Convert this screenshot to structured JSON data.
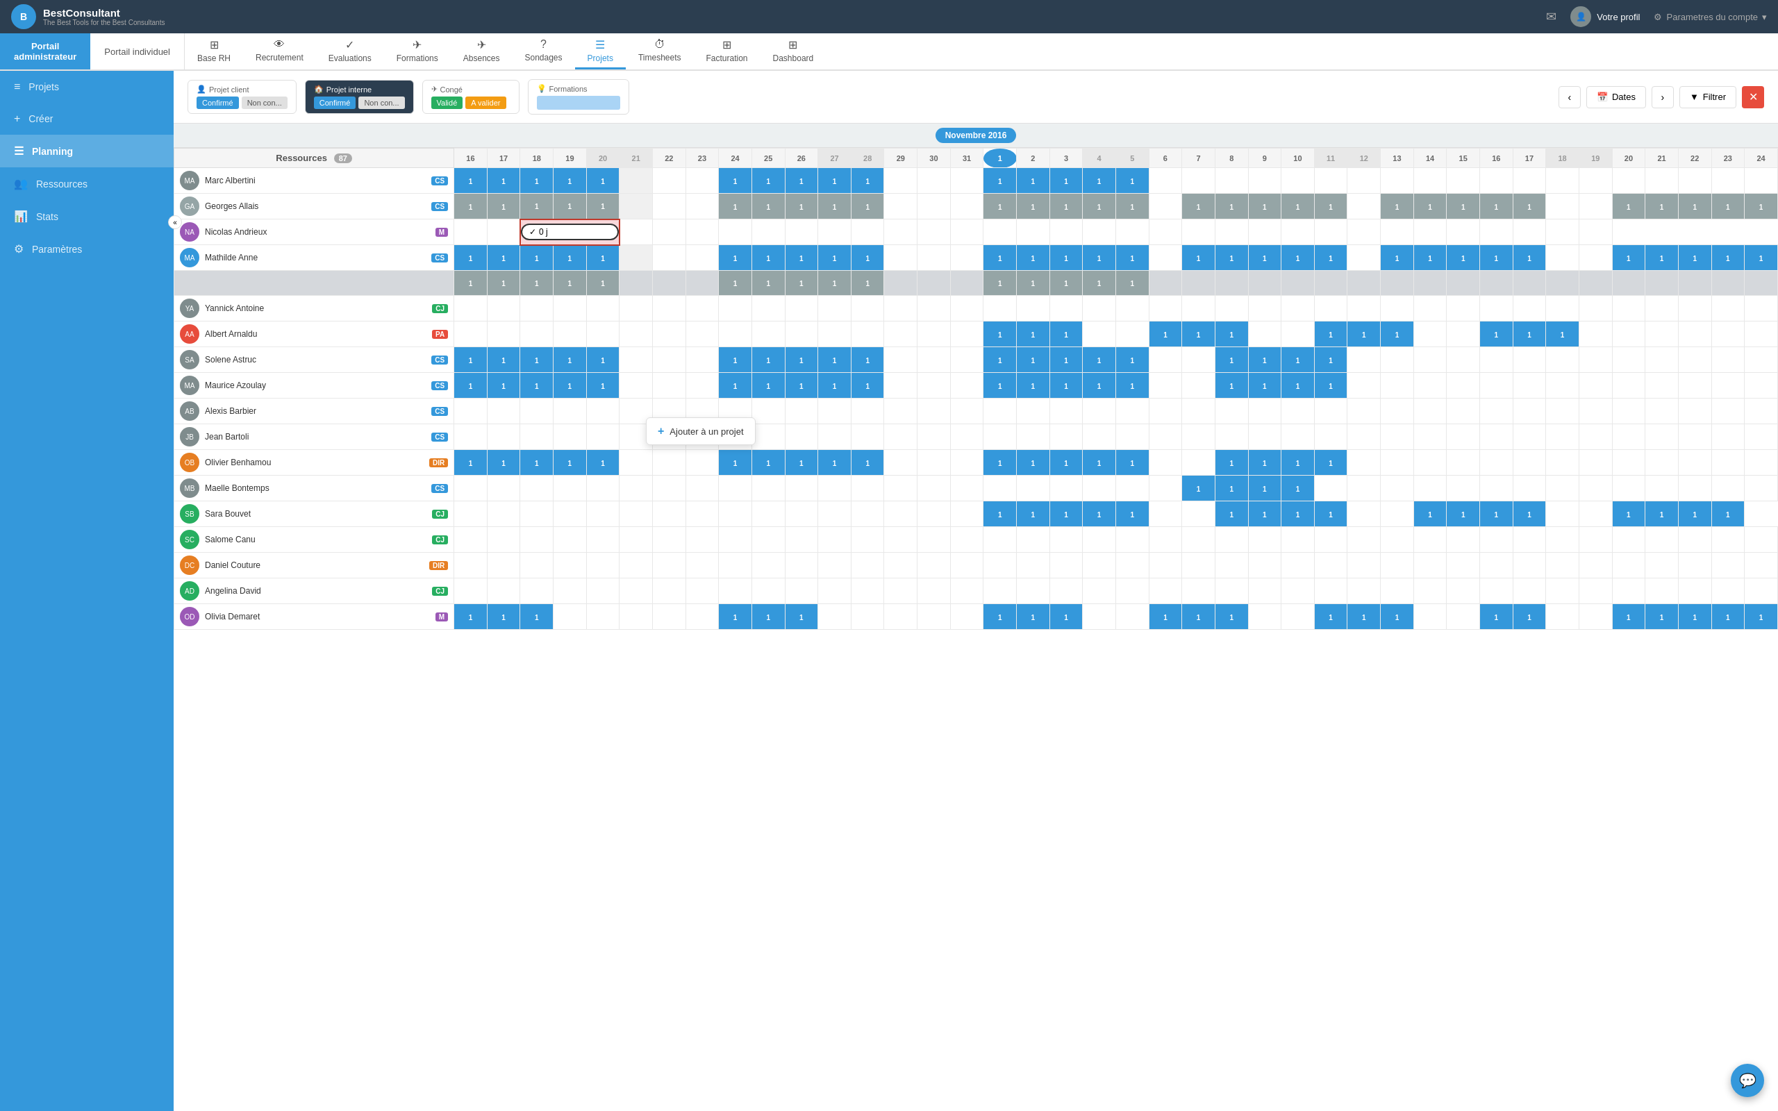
{
  "app": {
    "logo_letter": "B",
    "logo_title": "BestConsultant",
    "logo_sub": "The Best Tools for the Best Consultants",
    "top_right": {
      "mail_icon": "✉",
      "profile_label": "Votre profil",
      "params_label": "Parametres du compte"
    }
  },
  "nav": {
    "portal_admin_label": "Portail",
    "portal_admin_sub": "administrateur",
    "portal_individual_label": "Portail individuel",
    "tabs": [
      {
        "label": "Base RH",
        "icon": "⊞"
      },
      {
        "label": "Recrutement",
        "icon": "👁"
      },
      {
        "label": "Evaluations",
        "icon": "✓"
      },
      {
        "label": "Formations",
        "icon": "✈"
      },
      {
        "label": "Absences",
        "icon": "✈"
      },
      {
        "label": "Sondages",
        "icon": "?"
      },
      {
        "label": "Projets",
        "icon": "☰",
        "active": true
      },
      {
        "label": "Timesheets",
        "icon": "⏱"
      },
      {
        "label": "Facturation",
        "icon": "⊞"
      },
      {
        "label": "Dashboard",
        "icon": "⊞"
      }
    ]
  },
  "sidebar": {
    "items": [
      {
        "label": "Projets",
        "icon": "≡"
      },
      {
        "label": "Créer",
        "icon": "+"
      },
      {
        "label": "Planning",
        "icon": "☰",
        "active": true
      },
      {
        "label": "Ressources",
        "icon": "👥"
      },
      {
        "label": "Stats",
        "icon": "📊"
      },
      {
        "label": "Paramètres",
        "icon": "⚙"
      }
    ]
  },
  "toolbar": {
    "projet_client_label": "Projet client",
    "projet_client_icon": "👤",
    "btn_confirmed": "Confirmé",
    "btn_non_confirmed": "Non con...",
    "projet_interne_label": "Projet interne",
    "projet_interne_icon": "🏠",
    "btn_confirmed2": "Confirmé",
    "btn_non_confirmed2": "Non con...",
    "conge_label": "Congé",
    "conge_icon": "✈",
    "btn_valide": "Validé",
    "btn_avalider": "A valider",
    "formations_label": "Formations",
    "formations_icon": "💡",
    "dates_label": "Dates",
    "filter_label": "Filtrer",
    "resources_label": "Ressources",
    "resources_count": "87"
  },
  "calendar": {
    "month_label": "Novembre 2016",
    "days_first": [
      16,
      17,
      18,
      19,
      20,
      21,
      22,
      23,
      24,
      25,
      26,
      27,
      28,
      29,
      30,
      31,
      1,
      2,
      3,
      4,
      5,
      6,
      7,
      8,
      9,
      10,
      11,
      12,
      13,
      14,
      15,
      16,
      17,
      18,
      19,
      20,
      21,
      22,
      23,
      24
    ],
    "today": 1
  },
  "popup": {
    "label": "Ajouter à un projet",
    "icon": "+"
  },
  "resources": [
    {
      "name": "Marc Albertini",
      "role": "CS",
      "role_class": "role-cs",
      "color_avatar": "#7f8c8d"
    },
    {
      "name": "Georges Allais",
      "role": "CS",
      "role_class": "role-cs",
      "color_avatar": "#7f8c8d"
    },
    {
      "name": "Nicolas Andrieux",
      "role": "M",
      "role_class": "role-m",
      "color_avatar": "#9b59b6"
    },
    {
      "name": "Mathilde Anne",
      "role": "CS",
      "role_class": "role-cs",
      "color_avatar": "#3498db"
    },
    {
      "name": "Yannick Antoine",
      "role": "CJ",
      "role_class": "role-cj",
      "color_avatar": "#7f8c8d"
    },
    {
      "name": "Albert Arnaldu",
      "role": "PA",
      "role_class": "role-pa",
      "color_avatar": "#7f8c8d"
    },
    {
      "name": "Solene Astruc",
      "role": "CS",
      "role_class": "role-cs",
      "color_avatar": "#7f8c8d"
    },
    {
      "name": "Maurice Azoulay",
      "role": "CS",
      "role_class": "role-cs",
      "color_avatar": "#7f8c8d"
    },
    {
      "name": "Alexis Barbier",
      "role": "CS",
      "role_class": "role-cs",
      "color_avatar": "#7f8c8d"
    },
    {
      "name": "Jean Bartoli",
      "role": "CS",
      "role_class": "role-cs",
      "color_avatar": "#7f8c8d"
    },
    {
      "name": "Olivier Benhamou",
      "role": "DIR",
      "role_class": "role-dir",
      "color_avatar": "#7f8c8d"
    },
    {
      "name": "Maelle Bontemps",
      "role": "CS",
      "role_class": "role-cs",
      "color_avatar": "#7f8c8d"
    },
    {
      "name": "Sara Bouvet",
      "role": "CJ",
      "role_class": "role-cj",
      "color_avatar": "#7f8c8d"
    },
    {
      "name": "Salome Canu",
      "role": "CJ",
      "role_class": "role-cj",
      "color_avatar": "#7f8c8d"
    },
    {
      "name": "Daniel Couture",
      "role": "DIR",
      "role_class": "role-dir",
      "color_avatar": "#7f8c8d"
    },
    {
      "name": "Angelina David",
      "role": "CJ",
      "role_class": "role-cj",
      "color_avatar": "#7f8c8d"
    },
    {
      "name": "Olivia Demaret",
      "role": "M",
      "role_class": "role-m",
      "color_avatar": "#7f8c8d"
    }
  ]
}
